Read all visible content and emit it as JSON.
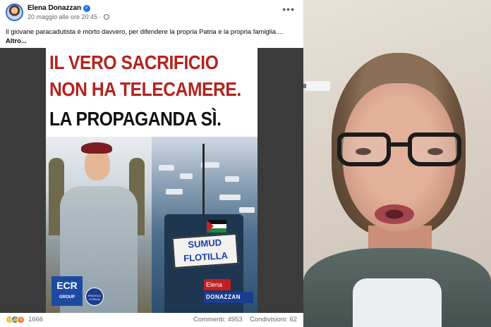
{
  "post": {
    "author": "Elena Donazzan",
    "timestamp": "20 maggio alle ore 20:45",
    "caption": "Il giovane paracadutista è morto davvero, per difendere la propria Patria e la propria famiglia....",
    "see_more": "Altro...",
    "options_icon": "more-horizontal-icon"
  },
  "poster": {
    "headline_1": "IL VERO SACRIFICIO",
    "headline_2": "NON HA TELECAMERE.",
    "headline_3": "LA PROPAGANDA SÌ.",
    "banner_line_1": "SUMUD",
    "banner_line_2": "FLOTILLA",
    "ecr_logo": "ECR",
    "ecr_logo_sub": "GROUP",
    "party_logo": "FRATELLI D'ITALIA",
    "signature_first": "Elena",
    "signature_last": "DONAZZAN"
  },
  "footer": {
    "reaction_icons": [
      "laugh-reaction-icon",
      "like-reaction-icon",
      "angry-reaction-icon"
    ],
    "reaction_count": "1666",
    "comments": "Commenti: 4953",
    "shares": "Condivisioni: 62"
  },
  "colors": {
    "headline_red": "#b4231d",
    "facebook_blue": "#1877f2",
    "secondary_text": "#65676b"
  }
}
